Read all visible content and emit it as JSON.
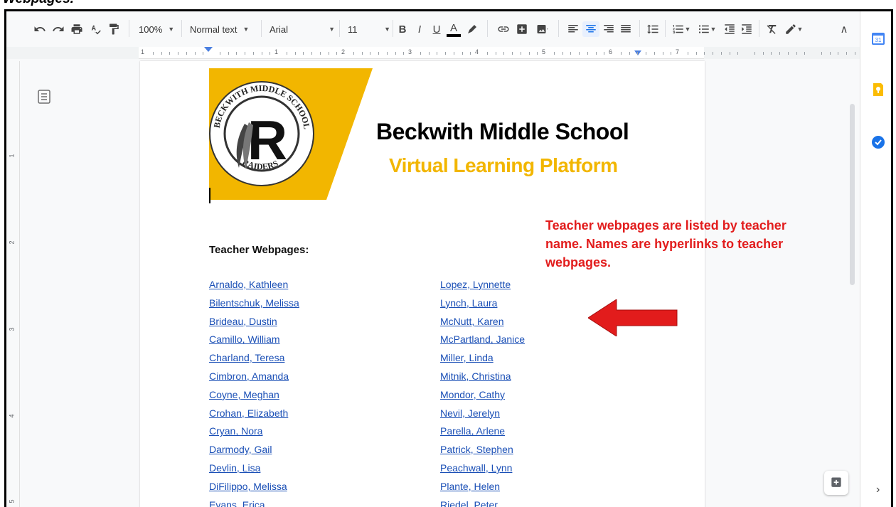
{
  "caption": "Webpages.",
  "toolbar": {
    "zoom": "100%",
    "style": "Normal text",
    "font": "Arial",
    "font_size": "11",
    "bold": "B",
    "italic": "I",
    "underline": "U",
    "text_color": "A"
  },
  "ruler": {
    "numbers": [
      "1",
      "1",
      "2",
      "3",
      "4",
      "5",
      "6",
      "7"
    ]
  },
  "vruler": {
    "numbers": [
      "1",
      "2",
      "3",
      "4",
      "5"
    ]
  },
  "document": {
    "school_name": "Beckwith Middle School",
    "platform_name": "Virtual Learning Platform",
    "logo": {
      "top_text": "BECKWITH MIDDLE SCHOOL",
      "bottom_text": "RAIDERS",
      "letter": "R"
    },
    "heading": "Teacher Webpages:",
    "annotation": "Teacher webpages are listed by teacher name.  Names are hyperlinks to teacher webpages.",
    "teachers_left": [
      "Arnaldo, Kathleen",
      "Bilentschuk, Melissa",
      "Brideau, Dustin",
      "Camillo, William",
      "Charland, Teresa",
      "Cimbron, Amanda",
      "Coyne, Meghan",
      "Crohan, Elizabeth",
      "Cryan, Nora",
      "Darmody, Gail",
      "Devlin, Lisa",
      "DiFilippo, Melissa",
      "Evans, Erica"
    ],
    "teachers_right": [
      "Lopez, Lynnette",
      "Lynch, Laura",
      "McNutt, Karen",
      "McPartland, Janice",
      "Miller, Linda",
      "Mitnik, Christina",
      "Mondor, Cathy",
      "Nevil, Jerelyn",
      "Parella, Arlene",
      "Patrick, Stephen",
      "Peachwall, Lynn",
      "Plante, Helen",
      "Riedel, Peter"
    ]
  },
  "side_panel": {
    "calendar_day": "31"
  },
  "colors": {
    "brand_yellow": "#f2b600",
    "annotation_red": "#e21c1c",
    "link_blue": "#1a4fb6"
  }
}
